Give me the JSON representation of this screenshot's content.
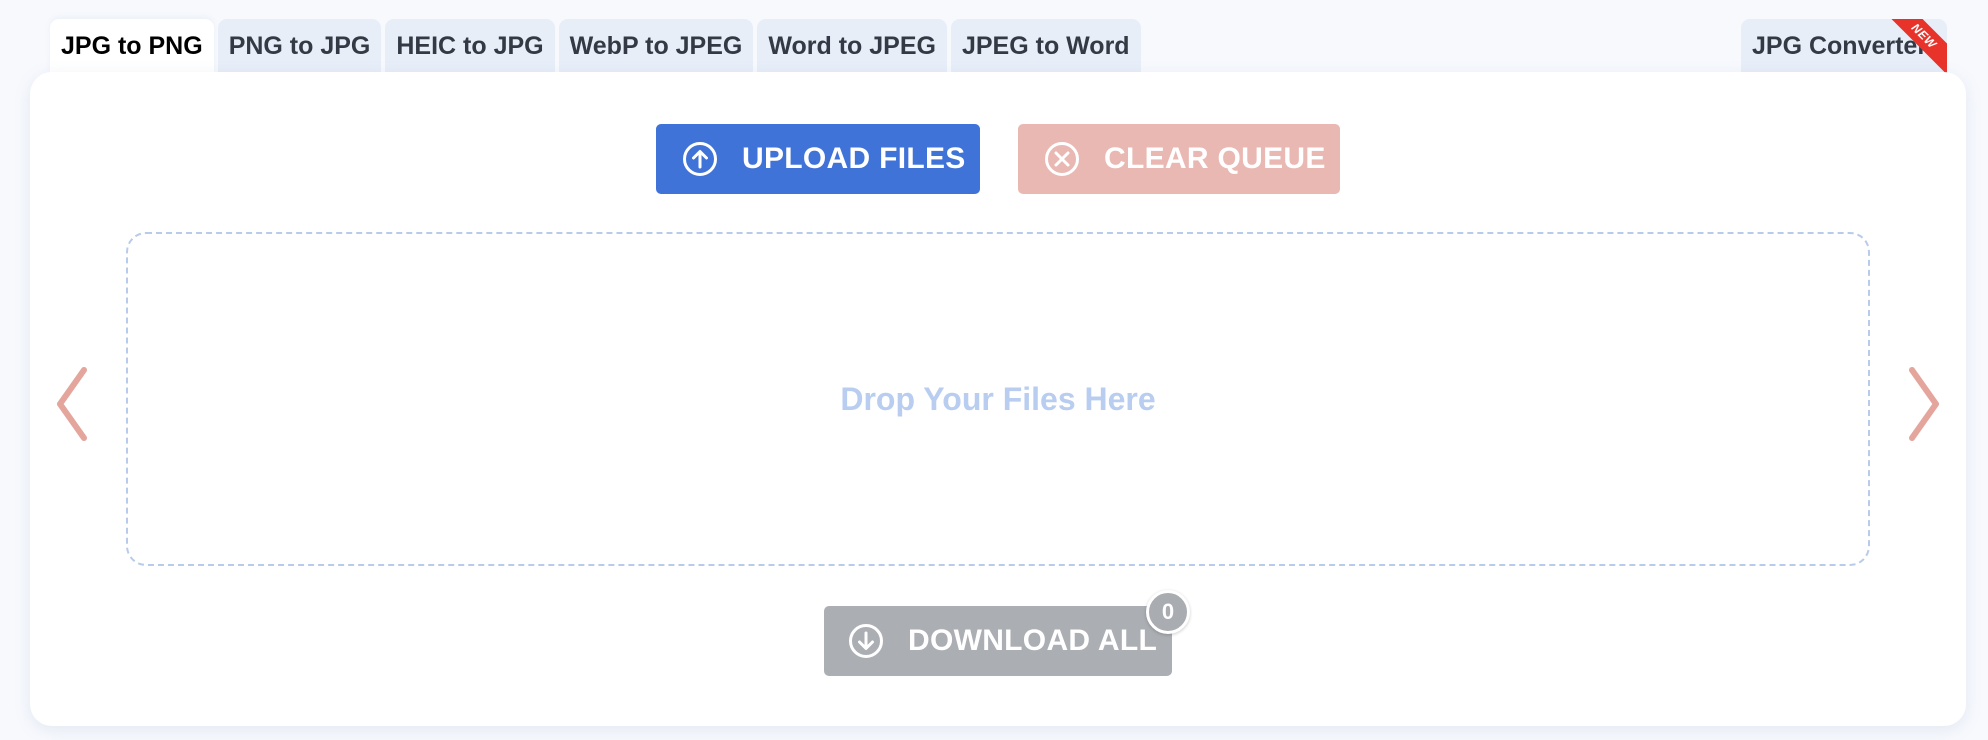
{
  "tabs": {
    "items": [
      {
        "label": "JPG to PNG",
        "active": true
      },
      {
        "label": "PNG to JPG",
        "active": false
      },
      {
        "label": "HEIC to JPG",
        "active": false
      },
      {
        "label": "WebP to JPEG",
        "active": false
      },
      {
        "label": "Word to JPEG",
        "active": false
      },
      {
        "label": "JPEG to Word",
        "active": false
      }
    ],
    "right": {
      "label": "JPG Converter",
      "ribbon": "NEW"
    }
  },
  "toolbar": {
    "upload_label": "UPLOAD FILES",
    "upload_icon": "arrow-up-circle-icon",
    "clear_label": "CLEAR QUEUE",
    "clear_icon": "x-circle-icon"
  },
  "dropzone": {
    "text": "Drop Your Files Here"
  },
  "navigation": {
    "prev_icon": "chevron-left-icon",
    "next_icon": "chevron-right-icon"
  },
  "download": {
    "label": "DOWNLOAD ALL",
    "icon": "arrow-down-circle-icon",
    "count": "0"
  },
  "colors": {
    "upload": "#3f73d8",
    "clear": "#e9b8b3",
    "download": "#abaeb3",
    "dropzone_text": "#b8cdf0",
    "arrows": "#e4a59d",
    "ribbon": "#e8332b"
  }
}
